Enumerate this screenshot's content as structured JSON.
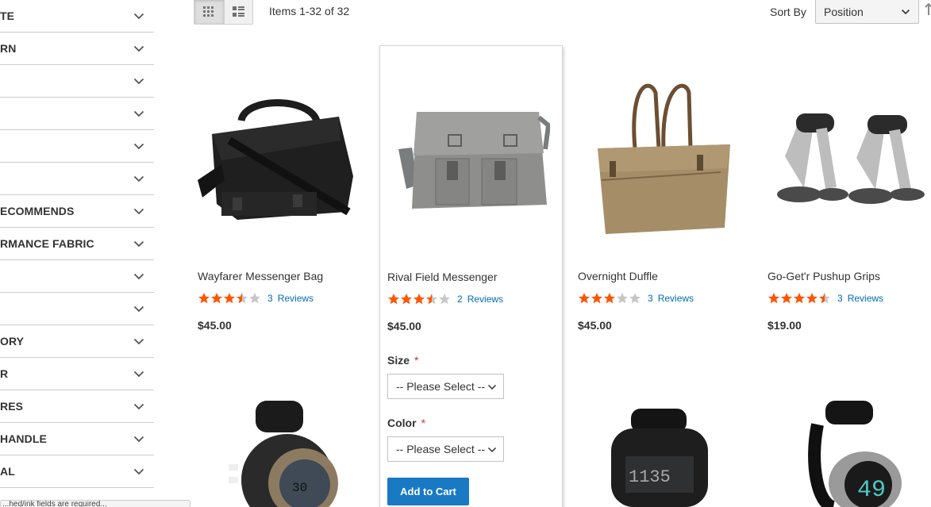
{
  "sidebar": {
    "filters": [
      {
        "label": "TE"
      },
      {
        "label": "RN"
      },
      {
        "label": ""
      },
      {
        "label": ""
      },
      {
        "label": ""
      },
      {
        "label": ""
      },
      {
        "label": "ECOMMENDS"
      },
      {
        "label": "RMANCE FABRIC"
      },
      {
        "label": ""
      },
      {
        "label": ""
      },
      {
        "label": "ORY"
      },
      {
        "label": "R"
      },
      {
        "label": "RES"
      },
      {
        "label": "HANDLE"
      },
      {
        "label": "AL"
      }
    ],
    "tooltip_text": "...hed/ink fields are required..."
  },
  "toolbar": {
    "mode_grid_icon": "grid-icon",
    "mode_list_icon": "list-icon",
    "amount_text": "Items 1-32 of 32",
    "sort_label": "Sort By",
    "sort_value": "Position"
  },
  "products": [
    {
      "name": "Wayfarer Messenger Bag",
      "rating": 3.5,
      "review_count": "3",
      "review_label": "Reviews",
      "price": "$45.00"
    },
    {
      "name": "Rival Field Messenger",
      "rating": 3.5,
      "review_count": "2",
      "review_label": "Reviews",
      "price": "$45.00"
    },
    {
      "name": "Overnight Duffle",
      "rating": 3,
      "review_count": "3",
      "review_label": "Reviews",
      "price": "$45.00"
    },
    {
      "name": "Go-Get'r Pushup Grips",
      "rating": 4.5,
      "review_count": "3",
      "review_label": "Reviews",
      "price": "$19.00"
    }
  ],
  "hovered_product": {
    "size_label": "Size",
    "size_required": "*",
    "size_placeholder": "-- Please Select --",
    "color_label": "Color",
    "color_required": "*",
    "color_placeholder": "-- Please Select --",
    "add_to_cart_label": "Add to Cart"
  },
  "colors": {
    "star_filled": "#ff5501",
    "star_empty": "#c7c7c7",
    "link": "#006bb4",
    "primary_button": "#1979c3",
    "required": "#e02b27"
  }
}
